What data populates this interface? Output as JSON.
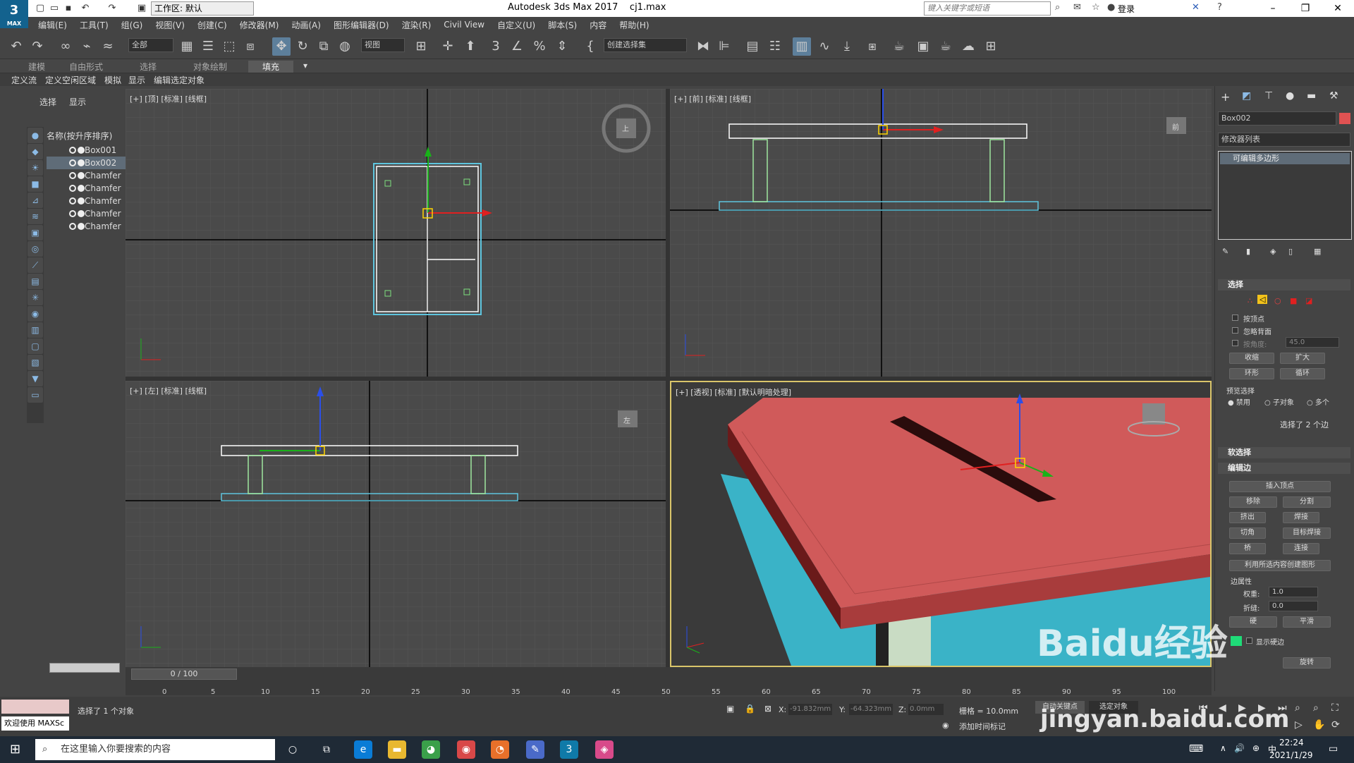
{
  "app": {
    "logo": "3",
    "logo_sub": "MAX",
    "title": "Autodesk 3ds Max 2017",
    "file": "cj1.max",
    "workspace": "工作区: 默认",
    "search_placeholder": "键入关键字或短语",
    "login": "登录"
  },
  "menu": [
    "编辑(E)",
    "工具(T)",
    "组(G)",
    "视图(V)",
    "创建(C)",
    "修改器(M)",
    "动画(A)",
    "图形编辑器(D)",
    "渲染(R)",
    "Civil View",
    "自定义(U)",
    "脚本(S)",
    "内容",
    "帮助(H)"
  ],
  "toolbar": {
    "filter": "全部",
    "refcoord": "视图",
    "selset": "创建选择集"
  },
  "ribbon": {
    "tabs": [
      "建模",
      "自由形式",
      "选择",
      "对象绘制",
      "填充"
    ],
    "active": "填充",
    "sub": [
      "定义流",
      "定义空闲区域",
      "模拟",
      "显示",
      "编辑选定对象"
    ]
  },
  "explorer": {
    "tabs": [
      "选择",
      "显示"
    ],
    "column": "名称(按升序排序)",
    "items": [
      "Box001",
      "Box002",
      "Chamfer",
      "Chamfer",
      "Chamfer",
      "Chamfer",
      "Chamfer"
    ],
    "selected_index": 1
  },
  "viewports": {
    "top": "[+] [顶] [标准] [线框]",
    "front": "[+] [前] [标准] [线框]",
    "left": "[+] [左] [标准] [线框]",
    "persp": "[+] [透视] [标准] [默认明暗处理]",
    "cube_top": "上",
    "cube_front": "前",
    "cube_left": "左"
  },
  "panel": {
    "object_name": "Box002",
    "object_color": "#e05252",
    "modifier_list": "修改器列表",
    "stack_item": "可编辑多边形",
    "selection": {
      "title": "选择",
      "by_vertex": "按顶点",
      "ignore_back": "忽略背面",
      "angle_label": "按角度:",
      "angle": "45.0",
      "shrink": "收缩",
      "grow": "扩大",
      "ring": "环形",
      "loop": "循环",
      "preview": "预览选择",
      "opt_off": "禁用",
      "opt_sub": "子对象",
      "opt_multi": "多个",
      "status": "选择了 2 个边"
    },
    "soft": "软选择",
    "edit_edges": {
      "title": "编辑边",
      "insert_vertex": "插入顶点",
      "remove": "移除",
      "split": "分割",
      "extrude": "挤出",
      "weld": "焊接",
      "chamfer": "切角",
      "target_weld": "目标焊接",
      "bridge": "桥",
      "connect": "连接",
      "create_shape": "利用所选内容创建图形",
      "edge_props": "边属性",
      "weight_label": "权重:",
      "weight": "1.0",
      "crease_label": "折缝:",
      "crease": "0.0",
      "hard": "硬",
      "smooth": "平滑",
      "show_hard": "显示硬边",
      "hard_color": "#1fdc78",
      "rotate": "旋转"
    }
  },
  "timeline": {
    "frame": "0 / 100",
    "ticks": [
      "0",
      "5",
      "10",
      "15",
      "20",
      "25",
      "30",
      "35",
      "40",
      "45",
      "50",
      "55",
      "60",
      "65",
      "70",
      "75",
      "80",
      "85",
      "90",
      "95",
      "100"
    ]
  },
  "status": {
    "welcome": "欢迎使用 MAXSc",
    "selected": "选择了 1 个对象",
    "x_label": "X:",
    "x": "-91.832mm",
    "y_label": "Y:",
    "y": "-64.323mm",
    "z_label": "Z:",
    "z": "0.0mm",
    "grid": "栅格 = 10.0mm",
    "add_time_tag": "添加时间标记",
    "auto_key": "自动关键点",
    "set_key": "选定对象"
  },
  "taskbar": {
    "search": "在这里输入你要搜索的内容",
    "time": "22:24",
    "date": "2021/1/29"
  },
  "watermark": {
    "logo": "Baidu经验",
    "url": "jingyan.baidu.com"
  }
}
